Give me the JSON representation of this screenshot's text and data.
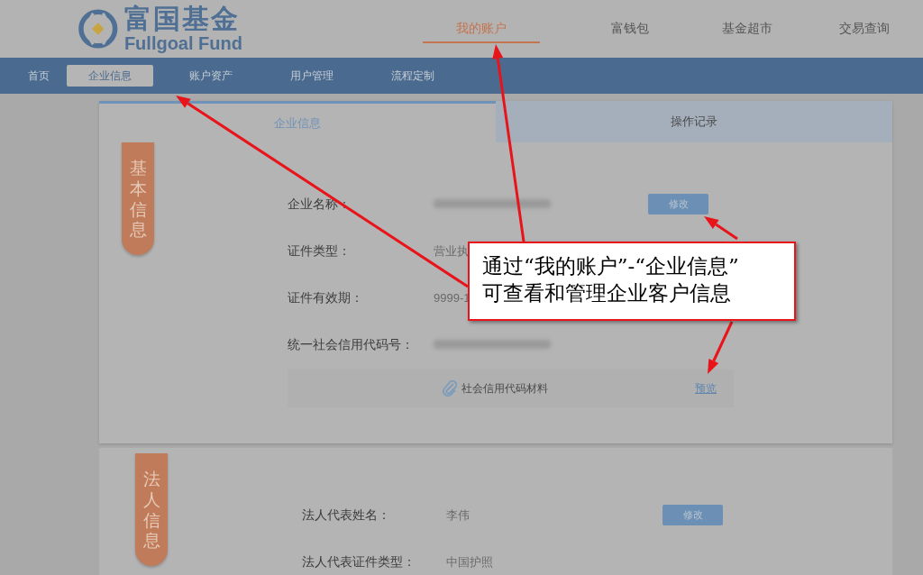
{
  "logo": {
    "name": "富国基金",
    "name_en": "Fullgoal Fund"
  },
  "top_nav": [
    {
      "label": "我的账户",
      "selected": true
    },
    {
      "label": "富钱包",
      "selected": false
    },
    {
      "label": "基金超市",
      "selected": false
    },
    {
      "label": "交易查询",
      "selected": false
    }
  ],
  "sub_nav": [
    {
      "label": "首页",
      "selected": false
    },
    {
      "label": "企业信息",
      "selected": true
    },
    {
      "label": "账户资产",
      "selected": false
    },
    {
      "label": "用户管理",
      "selected": false
    },
    {
      "label": "流程定制",
      "selected": false
    }
  ],
  "tabs": [
    {
      "label": "企业信息",
      "selected": true
    },
    {
      "label": "操作记录",
      "selected": false
    }
  ],
  "sections": [
    {
      "title": "基本信息",
      "rows": [
        {
          "label": "企业名称：",
          "kind": "blurred",
          "button": "修改"
        },
        {
          "label": "证件类型：",
          "kind": "text",
          "value": "营业执"
        },
        {
          "label": "证件有效期：",
          "kind": "text",
          "value": "9999-1"
        },
        {
          "label": "统一社会信用代码号：",
          "kind": "blurred"
        }
      ],
      "attachment": {
        "name": "社会信用代码材料",
        "link": "预览"
      }
    },
    {
      "title": "法人信息",
      "rows": [
        {
          "label": "法人代表姓名：",
          "kind": "text",
          "value": "李伟",
          "button": "修改"
        },
        {
          "label": "法人代表证件类型：",
          "kind": "text",
          "value": "中国护照"
        }
      ]
    }
  ],
  "callout": {
    "text": "通过“我的账户”-“企业信息”可查看和管理企业客户信息"
  }
}
